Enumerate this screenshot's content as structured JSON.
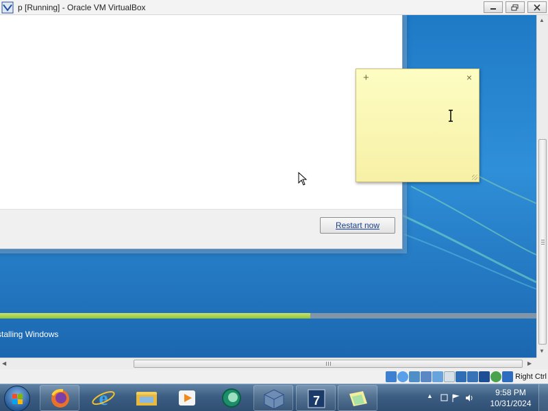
{
  "window": {
    "title": "p [Running] - Oracle VM VirtualBox",
    "controls": [
      "minimize",
      "restore",
      "close"
    ]
  },
  "installer": {
    "restart_button_label": "Restart now",
    "status_label": "stalling Windows",
    "progress_fraction": 0.578
  },
  "sticky_note": {
    "add_icon": "+",
    "close_icon": "×",
    "text": ""
  },
  "vbox_status": {
    "host_key_label": "Right Ctrl",
    "icons": [
      "hard-disk-icon",
      "optical-drive-icon",
      "audio-icon",
      "network-icon",
      "usb-icon",
      "shared-folders-icon",
      "display-icon",
      "video-capture-icon",
      "virtualization-icon",
      "mouse-integration-icon",
      "keyboard-icon"
    ]
  },
  "taskbar": {
    "pinned": [
      "firefox-icon",
      "internet-explorer-icon",
      "windows-explorer-icon",
      "media-player-icon",
      "browser-green-icon",
      "virtualbox-icon",
      "windows7-installer-icon",
      "sticky-notes-icon"
    ],
    "clock_time": "9:58 PM",
    "clock_date": "10/31/2024"
  },
  "colors": {
    "desktop_blue": "#1f7ac6",
    "progress_green": "#93c53a",
    "sticky_yellow": "#fdfdc3",
    "link_blue": "#1a3f8b"
  }
}
